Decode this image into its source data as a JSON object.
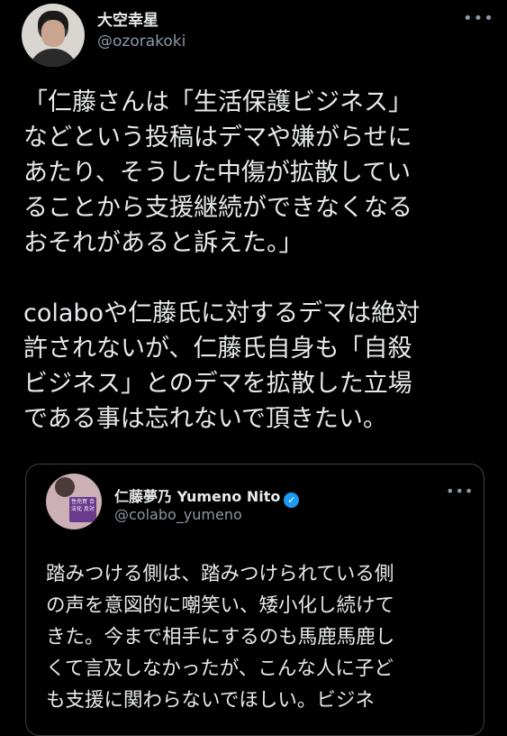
{
  "tweet": {
    "author_name": "大空幸星",
    "handle": "@ozorakoki",
    "more_glyph": "•••",
    "lines": [
      "「仁藤さんは「生活保護ビジネス」",
      "などという投稿はデマや嫌がらせに",
      "あたり、そうした中傷が拡散してい",
      "ることから支援継続ができなくなる",
      "おそれがあると訴えた。」",
      "colaboや仁藤氏に対するデマは絶対",
      "許されないが、仁藤氏自身も「自殺",
      "ビジネス」とのデマを拡散した立場",
      "である事は忘れないで頂きたい。"
    ]
  },
  "quoted": {
    "author_name": "仁藤夢乃 Yumeno Nito",
    "handle": "@colabo_yumeno",
    "verified_glyph": "✓",
    "more_glyph": "•••",
    "avatar_sign_text": "性売買 合法化 反対",
    "lines": [
      "踏みつける側は、踏みつけられている側",
      "の声を意図的に嘲笑い、矮小化し続けて",
      "きた。今まで相手にするのも馬鹿馬鹿し",
      "くて言及しなかったが、こんな人に子ど",
      "も支援に関わらないでほしい。ビジネ"
    ]
  },
  "colors": {
    "background": "#000000",
    "text": "#e7e9ea",
    "secondary": "#8b98a5",
    "verified": "#1d9bf0",
    "border": "#3d4145"
  }
}
